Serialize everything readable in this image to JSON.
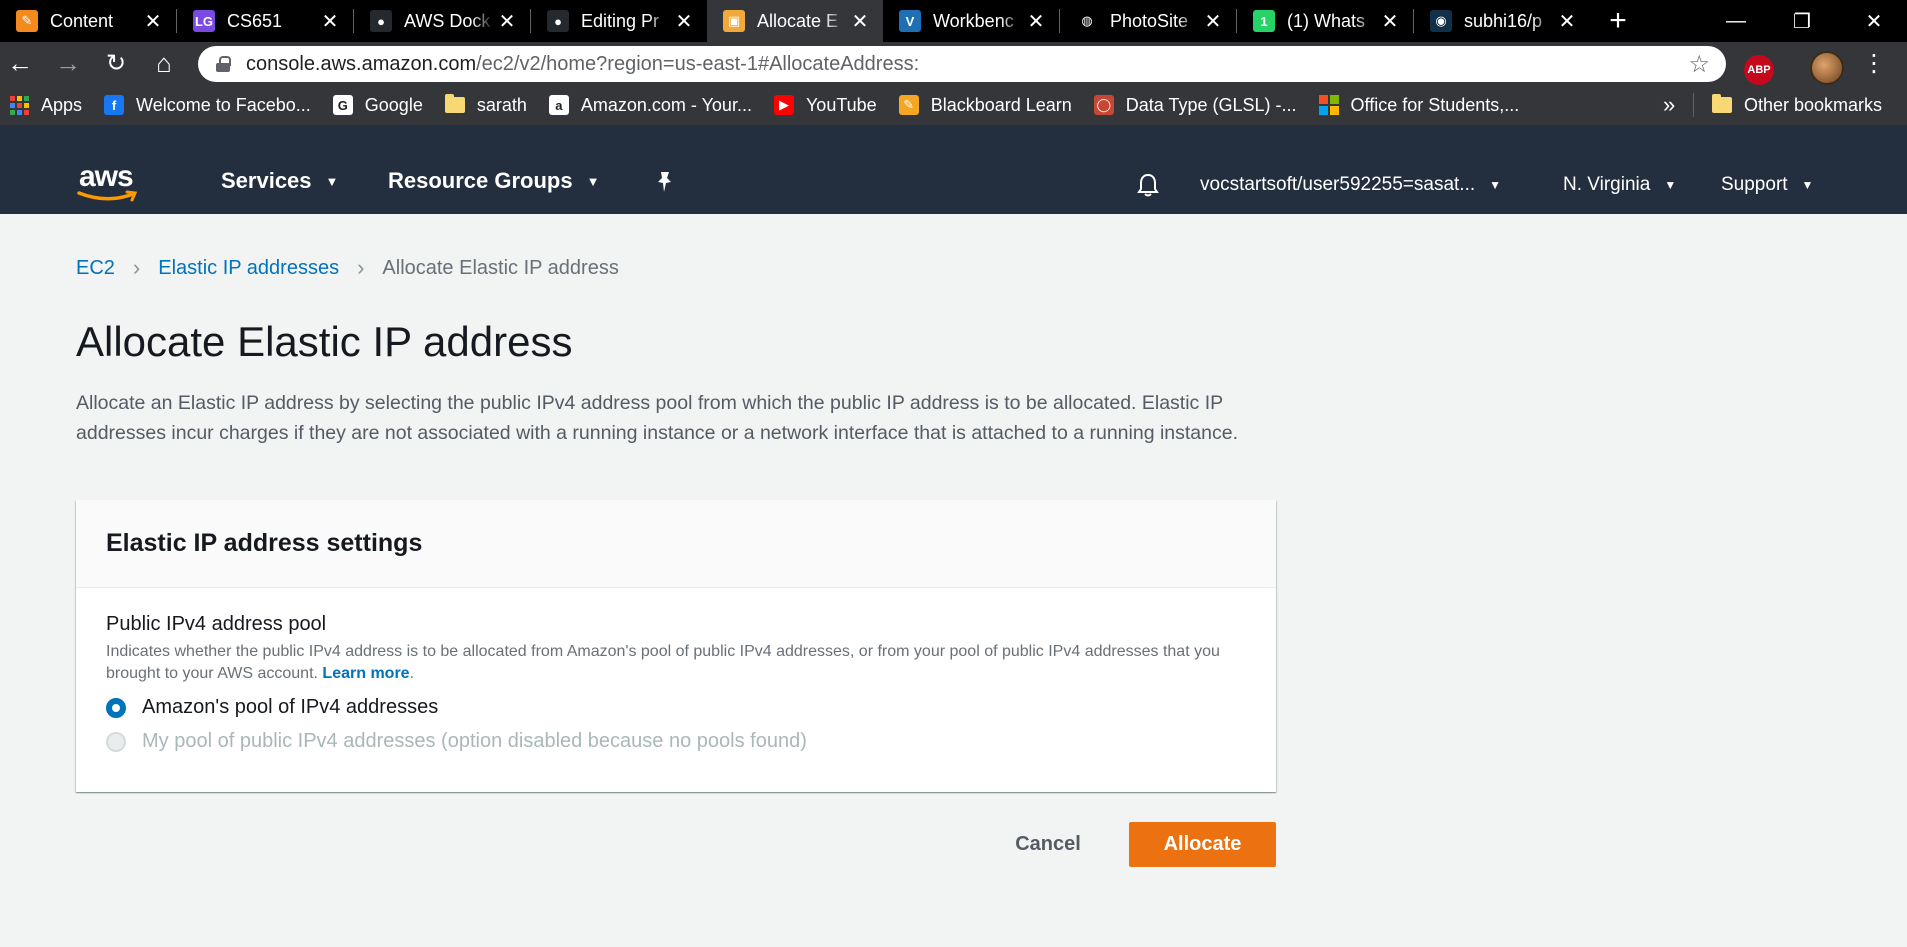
{
  "browser": {
    "tabs": [
      {
        "title": "Content",
        "icon": "pencil-favicon",
        "color": "#f28a1e",
        "glyph": "✎"
      },
      {
        "title": "CS651",
        "icon": "lg-favicon",
        "color": "#7b4ae2",
        "glyph": "LG"
      },
      {
        "title": "AWS Dock",
        "icon": "github-favicon",
        "color": "#24292e",
        "glyph": "●"
      },
      {
        "title": "Editing Pr",
        "icon": "github-favicon",
        "color": "#24292e",
        "glyph": "●"
      },
      {
        "title": "Allocate E",
        "icon": "aws-box-favicon",
        "color": "#f2a93b",
        "glyph": "▣",
        "active": true
      },
      {
        "title": "Workbenc",
        "icon": "vocareum-favicon",
        "color": "#1f6fb5",
        "glyph": "V"
      },
      {
        "title": "PhotoSite",
        "icon": "globe-favicon",
        "color": "#000000",
        "glyph": "◍"
      },
      {
        "title": "(1) Whats",
        "icon": "whatsapp-favicon",
        "color": "#25d366",
        "glyph": "1"
      },
      {
        "title": "subhi16/p",
        "icon": "docker-favicon",
        "color": "#13304a",
        "glyph": "◉"
      }
    ],
    "close_glyph": "✕",
    "new_tab_glyph": "+",
    "window_controls": {
      "minimize": "—",
      "restore": "❐",
      "close": "✕"
    },
    "nav": {
      "back": "←",
      "forward": "→",
      "reload": "↻",
      "home": "⌂"
    },
    "url_host": "console.aws.amazon.com",
    "url_path": "/ec2/v2/home?region=us-east-1#AllocateAddress:",
    "star_glyph": "☆",
    "abp_label": "ABP",
    "menu_glyph": "⋮",
    "bookmarks": [
      {
        "label": "Apps",
        "icon": "apps-grid-icon"
      },
      {
        "label": "Welcome to Facebo...",
        "icon": "facebook-icon",
        "color": "#1877f2",
        "glyph": "f"
      },
      {
        "label": "Google",
        "icon": "google-icon",
        "color": "#ffffff",
        "glyph": "G"
      },
      {
        "label": "sarath",
        "icon": "folder-icon"
      },
      {
        "label": "Amazon.com - Your...",
        "icon": "amazon-icon",
        "color": "#ffffff",
        "glyph": "a"
      },
      {
        "label": "YouTube",
        "icon": "youtube-icon",
        "color": "#ff0000",
        "glyph": "▶"
      },
      {
        "label": "Blackboard Learn",
        "icon": "blackboard-icon",
        "color": "#f5a623",
        "glyph": "✎"
      },
      {
        "label": "Data Type (GLSL) -...",
        "icon": "oracle-icon",
        "color": "#c74634",
        "glyph": "◯"
      },
      {
        "label": "Office for Students,...",
        "icon": "microsoft-icon"
      }
    ],
    "bookmarks_more": "»",
    "other_bookmarks": "Other bookmarks"
  },
  "aws": {
    "logo_text": "aws",
    "nav": {
      "services": "Services",
      "resource_groups": "Resource Groups",
      "account": "vocstartsoft/user592255=sasat...",
      "region": "N. Virginia",
      "support": "Support"
    },
    "caret": "▼",
    "pin_glyph": "📌",
    "bell_glyph": "🔔"
  },
  "breadcrumb": {
    "ec2": "EC2",
    "eips": "Elastic IP addresses",
    "current": "Allocate Elastic IP address",
    "chevron": "›"
  },
  "page": {
    "title": "Allocate Elastic IP address",
    "description": "Allocate an Elastic IP address by selecting the public IPv4 address pool from which the public IP address is to be allocated. Elastic IP addresses incur charges if they are not associated with a running instance or a network interface that is attached to a running instance."
  },
  "settings": {
    "heading": "Elastic IP address settings",
    "pool_label": "Public IPv4 address pool",
    "pool_desc": "Indicates whether the public IPv4 address is to be allocated from Amazon's pool of public IPv4 addresses, or from your pool of public IPv4 addresses that you brought to your AWS account.",
    "learn_more": "Learn more",
    "options": [
      {
        "label": "Amazon's pool of IPv4 addresses",
        "selected": true,
        "disabled": false
      },
      {
        "label": "My pool of public IPv4 addresses (option disabled because no pools found)",
        "selected": false,
        "disabled": true
      }
    ]
  },
  "actions": {
    "cancel": "Cancel",
    "allocate": "Allocate"
  },
  "colors": {
    "aws_nav": "#232f3e",
    "link": "#0073bb",
    "primary_button": "#ec7211",
    "page_bg": "#f2f3f3"
  }
}
